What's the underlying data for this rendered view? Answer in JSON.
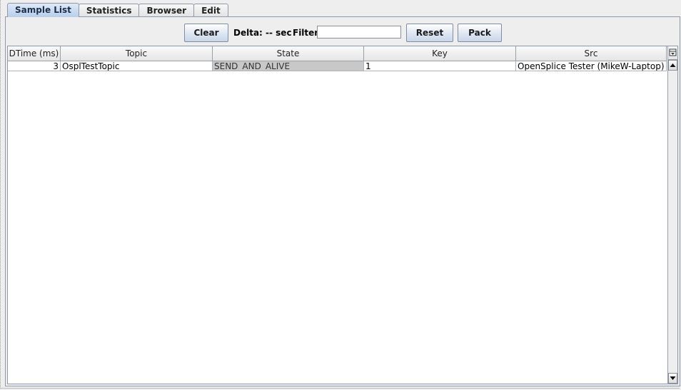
{
  "tabs": [
    {
      "label": "Sample List",
      "active": true
    },
    {
      "label": "Statistics",
      "active": false
    },
    {
      "label": "Browser",
      "active": false
    },
    {
      "label": "Edit",
      "active": false
    }
  ],
  "toolbar": {
    "clear_label": "Clear",
    "delta_label": "Delta: -- sec",
    "filter_label": "Filter",
    "filter_value": "",
    "reset_label": "Reset",
    "pack_label": "Pack"
  },
  "table": {
    "columns": [
      "DTime (ms)",
      "Topic",
      "State",
      "Key",
      "Src"
    ],
    "rows": [
      [
        "3",
        "OsplTestTopic",
        "SEND_AND_ALIVE",
        "1",
        "OpenSplice Tester (MikeW-Laptop)"
      ]
    ]
  },
  "icons": {
    "column_control": "column-control-icon",
    "scroll_up": "arrow-up-icon",
    "scroll_down": "arrow-down-icon"
  },
  "colors": {
    "active_tab": "#b8cfe9",
    "highlight_cell": "#c8c8c8",
    "border": "#8e9aab"
  }
}
